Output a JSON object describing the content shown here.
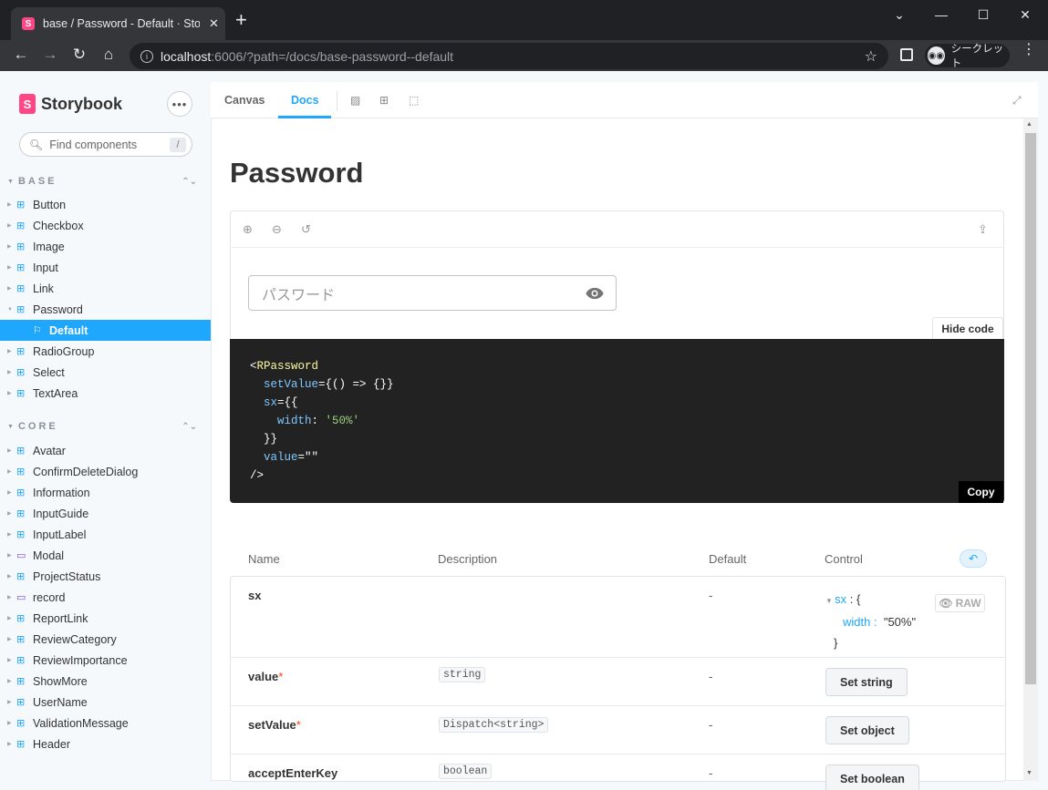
{
  "browser": {
    "tab_title": "base / Password - Default · Storybook",
    "url_host": "localhost",
    "url_rest": ":6006/?path=/docs/base-password--default",
    "profile_label": "シークレット"
  },
  "sidebar": {
    "brand": "Storybook",
    "search_placeholder": "Find components",
    "search_shortcut": "/",
    "groups": [
      {
        "name": "BASE",
        "items": [
          {
            "label": "Button"
          },
          {
            "label": "Checkbox"
          },
          {
            "label": "Image"
          },
          {
            "label": "Input"
          },
          {
            "label": "Link"
          },
          {
            "label": "Password"
          },
          {
            "label": "Default"
          },
          {
            "label": "RadioGroup"
          },
          {
            "label": "Select"
          },
          {
            "label": "TextArea"
          }
        ]
      },
      {
        "name": "CORE",
        "items": [
          {
            "label": "Avatar"
          },
          {
            "label": "ConfirmDeleteDialog"
          },
          {
            "label": "Information"
          },
          {
            "label": "InputGuide"
          },
          {
            "label": "InputLabel"
          },
          {
            "label": "Modal"
          },
          {
            "label": "ProjectStatus"
          },
          {
            "label": "record"
          },
          {
            "label": "ReportLink"
          },
          {
            "label": "ReviewCategory"
          },
          {
            "label": "ReviewImportance"
          },
          {
            "label": "ShowMore"
          },
          {
            "label": "UserName"
          },
          {
            "label": "ValidationMessage"
          },
          {
            "label": "Header"
          }
        ]
      }
    ]
  },
  "toolbar": {
    "tabs": [
      "Canvas",
      "Docs"
    ],
    "active_tab": "Docs"
  },
  "docs": {
    "title": "Password",
    "password_placeholder": "パスワード",
    "hide_code_label": "Hide code",
    "copy_label": "Copy",
    "code": {
      "open": "<",
      "component": "RPassword",
      "l2_attr": "setValue",
      "l2_val": "={() => {}}",
      "l3_attr": "sx",
      "l3_val": "={{",
      "l4_key": "width",
      "l4_colon": ": ",
      "l4_val": "'50%'",
      "l5": "}}",
      "l6_attr": "value",
      "l6_val": "=\"\"",
      "close": "/>"
    }
  },
  "args_table": {
    "headers": [
      "Name",
      "Description",
      "Default",
      "Control"
    ],
    "rows": [
      {
        "name": "sx",
        "required": "",
        "type": "",
        "default": "-"
      },
      {
        "name": "value",
        "required": "*",
        "type": "string",
        "default": "-",
        "control": "Set string"
      },
      {
        "name": "setValue",
        "required": "*",
        "type": "Dispatch<string>",
        "default": "-",
        "control": "Set object"
      },
      {
        "name": "acceptEnterKey",
        "required": "",
        "type": "boolean",
        "default": "-",
        "control": "Set boolean"
      }
    ],
    "sx_control": {
      "key": "sx",
      "sep": " : {",
      "inner_key": "width",
      "inner_sep": " : ",
      "inner_val": "\"50%\"",
      "close": "}"
    },
    "raw_label": "RAW"
  },
  "colors": {
    "accent": "#1ea7fd",
    "brand": "#ff4785",
    "code_bg": "#222222"
  }
}
